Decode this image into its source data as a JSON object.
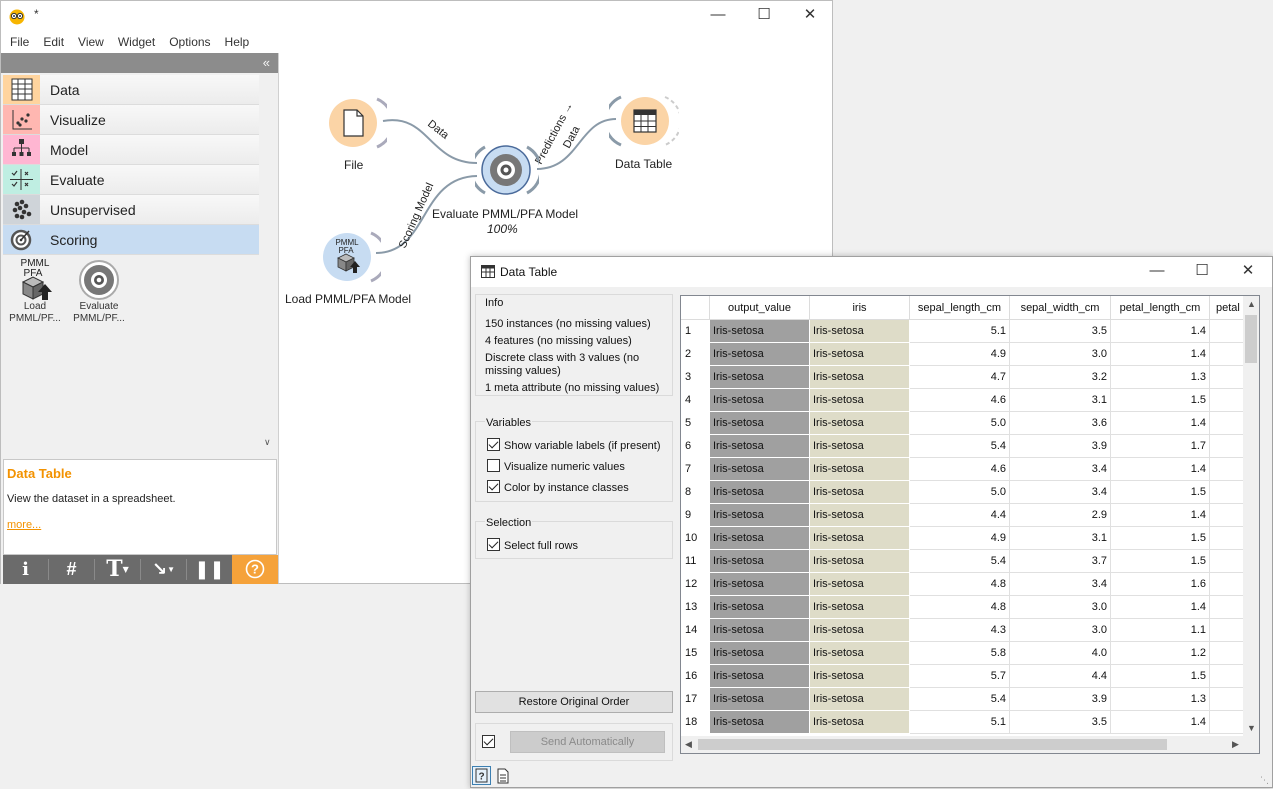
{
  "main_window": {
    "title": "*",
    "menu": [
      "File",
      "Edit",
      "View",
      "Widget",
      "Options",
      "Help"
    ],
    "categories": [
      {
        "label": "Data",
        "color": "#ffd49e"
      },
      {
        "label": "Visualize",
        "color": "#ffb7b1"
      },
      {
        "label": "Model",
        "color": "#ffb6d2"
      },
      {
        "label": "Evaluate",
        "color": "#bfeee2"
      },
      {
        "label": "Unsupervised",
        "color": "#cfd4d9"
      },
      {
        "label": "Scoring",
        "color": "#c7dcf2"
      }
    ],
    "tools": [
      {
        "label_line1": "Load",
        "label_line2": "PMML/PF...",
        "icon_text_1": "PMML",
        "icon_text_2": "PFA"
      },
      {
        "label_line1": "Evaluate",
        "label_line2": "PMML/PF..."
      }
    ],
    "description": {
      "title": "Data Table",
      "text": "View the dataset in a spreadsheet.",
      "more": "more..."
    },
    "canvas": {
      "nodes": {
        "file": "File",
        "load": "Load PMML/PFA Model",
        "load_icon_1": "PMML",
        "load_icon_2": "PFA",
        "evaluate": "Evaluate PMML/PFA Model",
        "evaluate_progress": "100%",
        "table": "Data Table"
      },
      "links": {
        "file_eval": "Data",
        "load_eval": "Scoring Model",
        "eval_table_1": "Predictions →",
        "eval_table_2": "Data"
      }
    },
    "colors": {
      "accent": "#f39200",
      "selected": "#c7dcf2"
    }
  },
  "data_table_window": {
    "title": "Data Table",
    "info": {
      "title": "Info",
      "lines": [
        "150 instances (no missing values)",
        "4 features (no missing values)",
        "Discrete class with 3 values (no missing values)",
        "1 meta attribute (no missing values)"
      ]
    },
    "variables": {
      "title": "Variables",
      "options": [
        {
          "label": "Show variable labels (if present)",
          "checked": true
        },
        {
          "label": "Visualize numeric values",
          "checked": false
        },
        {
          "label": "Color by instance classes",
          "checked": true
        }
      ]
    },
    "selection": {
      "title": "Selection",
      "options": [
        {
          "label": "Select full rows",
          "checked": true
        }
      ]
    },
    "restore_button": "Restore Original Order",
    "send_button": "Send Automatically",
    "send_checked": true,
    "columns": [
      "output_value",
      "iris",
      "sepal_length_cm",
      "sepal_width_cm",
      "petal_length_cm",
      "petal"
    ],
    "rows": [
      {
        "n": "1",
        "output_value": "Iris-setosa",
        "iris": "Iris-setosa",
        "sepal_length_cm": "5.1",
        "sepal_width_cm": "3.5",
        "petal_length_cm": "1.4"
      },
      {
        "n": "2",
        "output_value": "Iris-setosa",
        "iris": "Iris-setosa",
        "sepal_length_cm": "4.9",
        "sepal_width_cm": "3.0",
        "petal_length_cm": "1.4"
      },
      {
        "n": "3",
        "output_value": "Iris-setosa",
        "iris": "Iris-setosa",
        "sepal_length_cm": "4.7",
        "sepal_width_cm": "3.2",
        "petal_length_cm": "1.3"
      },
      {
        "n": "4",
        "output_value": "Iris-setosa",
        "iris": "Iris-setosa",
        "sepal_length_cm": "4.6",
        "sepal_width_cm": "3.1",
        "petal_length_cm": "1.5"
      },
      {
        "n": "5",
        "output_value": "Iris-setosa",
        "iris": "Iris-setosa",
        "sepal_length_cm": "5.0",
        "sepal_width_cm": "3.6",
        "petal_length_cm": "1.4"
      },
      {
        "n": "6",
        "output_value": "Iris-setosa",
        "iris": "Iris-setosa",
        "sepal_length_cm": "5.4",
        "sepal_width_cm": "3.9",
        "petal_length_cm": "1.7"
      },
      {
        "n": "7",
        "output_value": "Iris-setosa",
        "iris": "Iris-setosa",
        "sepal_length_cm": "4.6",
        "sepal_width_cm": "3.4",
        "petal_length_cm": "1.4"
      },
      {
        "n": "8",
        "output_value": "Iris-setosa",
        "iris": "Iris-setosa",
        "sepal_length_cm": "5.0",
        "sepal_width_cm": "3.4",
        "petal_length_cm": "1.5"
      },
      {
        "n": "9",
        "output_value": "Iris-setosa",
        "iris": "Iris-setosa",
        "sepal_length_cm": "4.4",
        "sepal_width_cm": "2.9",
        "petal_length_cm": "1.4"
      },
      {
        "n": "10",
        "output_value": "Iris-setosa",
        "iris": "Iris-setosa",
        "sepal_length_cm": "4.9",
        "sepal_width_cm": "3.1",
        "petal_length_cm": "1.5"
      },
      {
        "n": "11",
        "output_value": "Iris-setosa",
        "iris": "Iris-setosa",
        "sepal_length_cm": "5.4",
        "sepal_width_cm": "3.7",
        "petal_length_cm": "1.5"
      },
      {
        "n": "12",
        "output_value": "Iris-setosa",
        "iris": "Iris-setosa",
        "sepal_length_cm": "4.8",
        "sepal_width_cm": "3.4",
        "petal_length_cm": "1.6"
      },
      {
        "n": "13",
        "output_value": "Iris-setosa",
        "iris": "Iris-setosa",
        "sepal_length_cm": "4.8",
        "sepal_width_cm": "3.0",
        "petal_length_cm": "1.4"
      },
      {
        "n": "14",
        "output_value": "Iris-setosa",
        "iris": "Iris-setosa",
        "sepal_length_cm": "4.3",
        "sepal_width_cm": "3.0",
        "petal_length_cm": "1.1"
      },
      {
        "n": "15",
        "output_value": "Iris-setosa",
        "iris": "Iris-setosa",
        "sepal_length_cm": "5.8",
        "sepal_width_cm": "4.0",
        "petal_length_cm": "1.2"
      },
      {
        "n": "16",
        "output_value": "Iris-setosa",
        "iris": "Iris-setosa",
        "sepal_length_cm": "5.7",
        "sepal_width_cm": "4.4",
        "petal_length_cm": "1.5"
      },
      {
        "n": "17",
        "output_value": "Iris-setosa",
        "iris": "Iris-setosa",
        "sepal_length_cm": "5.4",
        "sepal_width_cm": "3.9",
        "petal_length_cm": "1.3"
      },
      {
        "n": "18",
        "output_value": "Iris-setosa",
        "iris": "Iris-setosa",
        "sepal_length_cm": "5.1",
        "sepal_width_cm": "3.5",
        "petal_length_cm": "1.4"
      }
    ]
  }
}
